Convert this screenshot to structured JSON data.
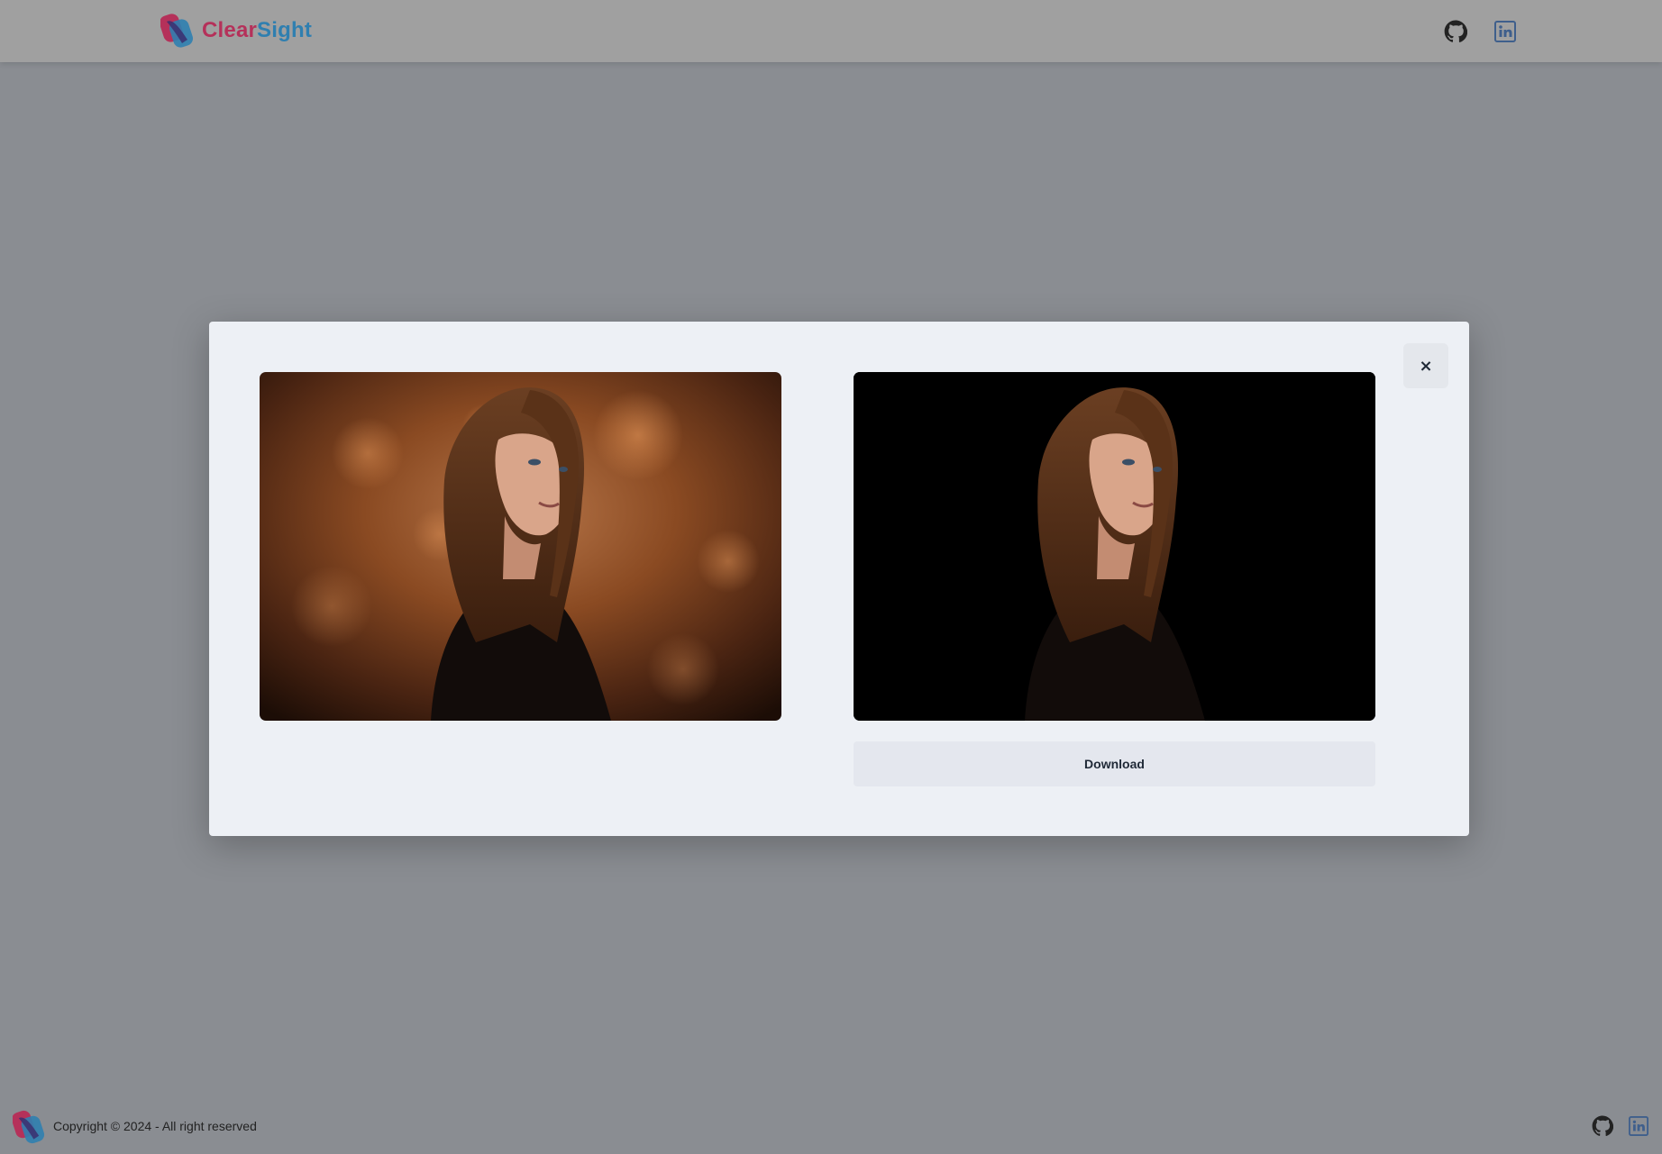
{
  "header": {
    "brand_part1": "Clear",
    "brand_part2": "Sight",
    "brand_colors": {
      "clear": "#b5315a",
      "sight": "#2f7fb0"
    },
    "icons": [
      "github-icon",
      "linkedin-icon"
    ]
  },
  "modal": {
    "close_label": "×",
    "original_image_icon": "portrait-photo-original",
    "result_image_icon": "portrait-photo-background-removed",
    "download_label": "Download"
  },
  "footer": {
    "copyright": "Copyright © 2024 - All right reserved",
    "icons": [
      "github-icon",
      "linkedin-icon"
    ]
  },
  "colors": {
    "page_dim": "#8a8d92",
    "header_bg": "#a0a0a0",
    "modal_bg": "#edf0f5",
    "button_bg": "#e4e7ee",
    "linkedin": "#3f5f8c"
  }
}
